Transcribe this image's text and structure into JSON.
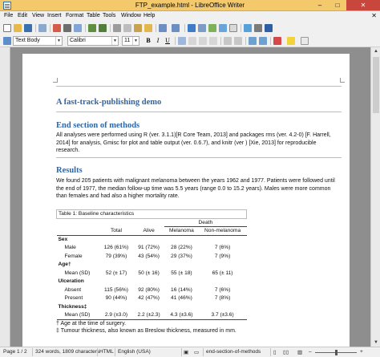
{
  "window": {
    "title": "FTP_example.html - LibreOffice Writer",
    "min": "–",
    "max": "□",
    "close": "✕"
  },
  "menu": [
    "File",
    "Edit",
    "View",
    "Insert",
    "Format",
    "Table",
    "Tools",
    "Window",
    "Help"
  ],
  "toolbar": {
    "paragraph_style": "Text Body",
    "font_name": "Calibri",
    "font_size": "11",
    "bold": "B",
    "italic": "I",
    "underline": "U"
  },
  "document": {
    "title": "A fast-track-publishing demo",
    "section_methods": {
      "heading": "End section of methods",
      "lines": [
        "All analyses were performed using R (ver. 3.1.1)[R Core Team, 2013] and packages rms (ver. 4.2-0) [F. Harrell,",
        "2014] for analysis, Gmisc for plot and table output (ver. 0.6.7), and knitr (ver ) [Xie, 2013] for reproducible",
        "research."
      ]
    },
    "section_results": {
      "heading": "Results",
      "lines": [
        "We found 205 patients with malignant melanoma between the years 1962 and 1977. Patients were followed until",
        "the end of 1977, the median follow-up time was 5.5 years (range 0.0 to 15.2 years). Males were more common",
        "than females and had also a higher mortality rate."
      ]
    },
    "table": {
      "caption": "Table 1: Baseline characteristics",
      "death_header": "Death",
      "columns": [
        "Total",
        "Alive",
        "Melanoma",
        "Non-melanoma"
      ],
      "groups": [
        {
          "label": "Sex",
          "rows": [
            {
              "label": "Male",
              "values": [
                "126 (61%)",
                "91 (72%)",
                "28 (22%)",
                "7 (6%)"
              ]
            },
            {
              "label": "Female",
              "values": [
                "79 (39%)",
                "43 (54%)",
                "29 (37%)",
                "7 (9%)"
              ]
            }
          ]
        },
        {
          "label": "Age†",
          "rows": [
            {
              "label": "Mean (SD)",
              "values": [
                "52 (± 17)",
                "50 (± 16)",
                "55 (± 18)",
                "65 (± 11)"
              ]
            }
          ]
        },
        {
          "label": "Ulceration",
          "rows": [
            {
              "label": "Absent",
              "values": [
                "115 (56%)",
                "92 (80%)",
                "16 (14%)",
                "7 (6%)"
              ]
            },
            {
              "label": "Present",
              "values": [
                "90 (44%)",
                "42 (47%)",
                "41 (46%)",
                "7 (8%)"
              ]
            }
          ]
        },
        {
          "label": "Thickness‡",
          "rows": [
            {
              "label": "Mean (SD)",
              "values": [
                "2.9 (±3.0)",
                "2.2 (±2.3)",
                "4.3 (±3.6)",
                "3.7 (±3.6)"
              ]
            }
          ]
        }
      ],
      "footnotes": [
        "† Age at the time of surgery.",
        "‡ Tumour thickness, also known as Breslow thickness, measured in mm."
      ]
    }
  },
  "status": {
    "page": "Page 1 / 2",
    "words": "324 words, 1809 characters",
    "format": "HTML",
    "language": "English (USA)",
    "section": "end-section-of-methods",
    "zoom_level": 0.5
  }
}
